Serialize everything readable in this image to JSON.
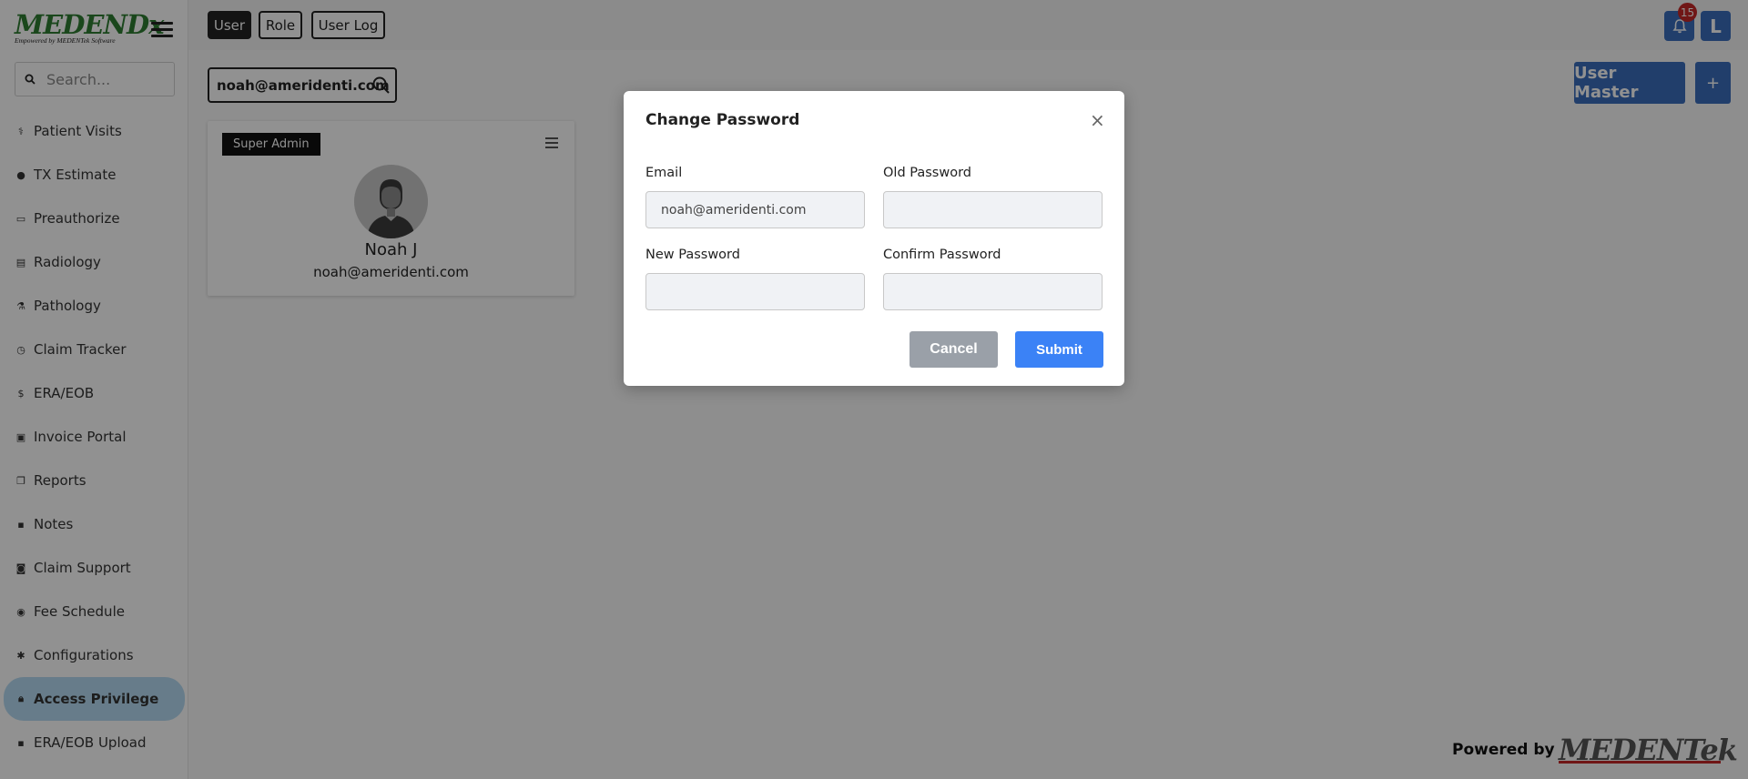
{
  "logo": {
    "brand": "MEDENDx",
    "tm": "™",
    "tagline": "Empowered by MEDENTek Software"
  },
  "sidebar": {
    "search_placeholder": "Search...",
    "items": [
      {
        "label": "Patient Visits",
        "icon": "stethoscope-icon"
      },
      {
        "label": "TX Estimate",
        "icon": "circle-icon"
      },
      {
        "label": "Preauthorize",
        "icon": "monitor-icon"
      },
      {
        "label": "Radiology",
        "icon": "list-icon"
      },
      {
        "label": "Pathology",
        "icon": "microscope-icon"
      },
      {
        "label": "Claim Tracker",
        "icon": "clock-icon"
      },
      {
        "label": "ERA/EOB",
        "icon": "dollar-icon"
      },
      {
        "label": "Invoice Portal",
        "icon": "invoice-icon"
      },
      {
        "label": "Reports",
        "icon": "reports-icon"
      },
      {
        "label": "Notes",
        "icon": "notes-icon"
      },
      {
        "label": "Claim Support",
        "icon": "support-icon"
      },
      {
        "label": "Fee Schedule",
        "icon": "fee-icon"
      },
      {
        "label": "Configurations",
        "icon": "gear-icon"
      },
      {
        "label": "Access Privilege",
        "icon": "lock-icon"
      },
      {
        "label": "ERA/EOB Upload",
        "icon": "upload-icon"
      }
    ]
  },
  "topbar": {
    "tabs": [
      {
        "label": "User"
      },
      {
        "label": "Role"
      },
      {
        "label": "User Log"
      }
    ],
    "notification_count": "15",
    "avatar_letter": "L"
  },
  "main": {
    "search_value": "noah@ameridenti.com",
    "user_master_label": "User Master",
    "add_label": "+",
    "card": {
      "role": "Super Admin",
      "name": "Noah J",
      "email": "noah@ameridenti.com"
    },
    "powered_by": "Powered by",
    "footer_brand": "MEDENTek"
  },
  "modal": {
    "title": "Change Password",
    "close": "×",
    "email_label": "Email",
    "email_value": "noah@ameridenti.com",
    "old_password_label": "Old Password",
    "new_password_label": "New Password",
    "confirm_password_label": "Confirm Password",
    "cancel_label": "Cancel",
    "submit_label": "Submit"
  },
  "colors": {
    "accent": "#3a6dbd",
    "submit": "#3b82f6",
    "active_nav": "#b5dbf2",
    "badge": "#c62828",
    "brand_green": "#2e7d32"
  }
}
